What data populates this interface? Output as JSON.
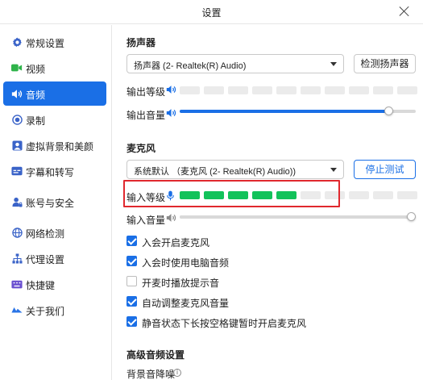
{
  "window": {
    "title": "设置"
  },
  "sidebar": {
    "items": [
      {
        "label": "常规设置",
        "icon": "gear-icon"
      },
      {
        "label": "视频",
        "icon": "video-icon"
      },
      {
        "label": "音频",
        "icon": "speaker-icon",
        "active": true
      },
      {
        "label": "录制",
        "icon": "record-icon"
      },
      {
        "label": "虚拟背景和美颜",
        "icon": "portrait-icon"
      },
      {
        "label": "字幕和转写",
        "icon": "subtitles-icon"
      },
      {
        "label": "账号与安全",
        "icon": "account-lock-icon"
      },
      {
        "label": "网络检测",
        "icon": "globe-icon"
      },
      {
        "label": "代理设置",
        "icon": "network-tree-icon"
      },
      {
        "label": "快捷键",
        "icon": "keyboard-icon"
      },
      {
        "label": "关于我们",
        "icon": "logo-icon"
      }
    ],
    "accent": "#1a6fe6"
  },
  "speaker": {
    "title": "扬声器",
    "device": "扬声器 (2- Realtek(R) Audio)",
    "test_button": "检测扬声器",
    "output_level_label": "输出等级",
    "output_level_lit": 0,
    "output_level_segments": 10,
    "output_volume_label": "输出音量",
    "output_volume": 0.9
  },
  "microphone": {
    "title": "麦克风",
    "device": "系统默认 （麦克风 (2- Realtek(R) Audio))",
    "test_button": "停止测试",
    "input_level_label": "输入等级",
    "input_level_lit": 5,
    "input_level_segments": 10,
    "level_color": "#12c25a",
    "input_volume_label": "输入音量",
    "input_volume": 1.0
  },
  "options": [
    {
      "label": "入会开启麦克风",
      "checked": true
    },
    {
      "label": "入会时使用电脑音频",
      "checked": true
    },
    {
      "label": "开麦时播放提示音",
      "checked": false
    },
    {
      "label": "自动调整麦克风音量",
      "checked": true
    },
    {
      "label": "静音状态下长按空格键暂时开启麦克风",
      "checked": true
    }
  ],
  "advanced": {
    "title": "高级音频设置",
    "noise_label": "背景音降噪"
  },
  "highlight_color": "#e0282e"
}
